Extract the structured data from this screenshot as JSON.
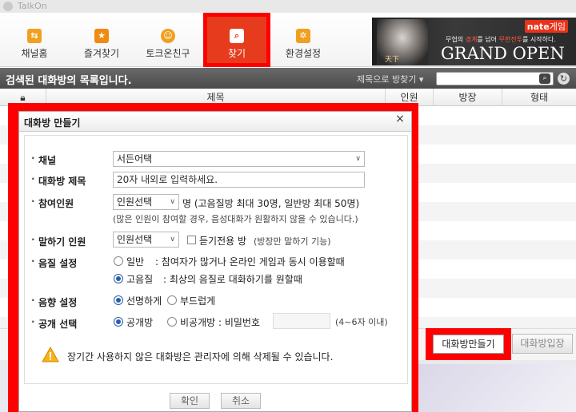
{
  "window": {
    "title": "TalkOn"
  },
  "toolbar": {
    "items": [
      {
        "label": "채널홈",
        "icon": "channel-home-icon",
        "color": "#f0a020"
      },
      {
        "label": "즐겨찾기",
        "icon": "star-icon",
        "color": "#f08a10"
      },
      {
        "label": "토크온친구",
        "icon": "friend-icon",
        "color": "#f0a020"
      },
      {
        "label": "찾기",
        "icon": "search-icon",
        "color": "#e63b1c",
        "active": true
      },
      {
        "label": "환경설정",
        "icon": "gear-icon",
        "color": "#f0a020"
      }
    ]
  },
  "banner": {
    "brand": "nate",
    "brand_suffix": "게임",
    "copy_pre": "무협의 ",
    "copy_em1": "경계",
    "copy_mid": "를 넘어 ",
    "copy_em2": "무한전투",
    "copy_post": "를 시작하다.",
    "headline": "GRAND OPEN",
    "logo": "天下"
  },
  "search": {
    "title": "검색된 대화방의 목록입니다.",
    "mode": "제목으로 방찾기 ▾",
    "query": ""
  },
  "table": {
    "columns": [
      "제목",
      "인원",
      "방장",
      "형태"
    ]
  },
  "buttons": {
    "create_room": "대화방만들기",
    "enter_room": "대화방입장"
  },
  "dialog": {
    "title": "대화방 만들기",
    "close": "×",
    "channel": {
      "label": "채널",
      "value": "서든어택"
    },
    "room_title": {
      "label": "대화방 제목",
      "placeholder": "20자 내외로 입력하세요."
    },
    "members": {
      "label": "참여인원",
      "value": "인원선택",
      "suffix": "명 (고음질방 최대 30명, 일반방 최대 50명)",
      "note": "(많은 인원이 참여할 경우, 음성대화가 원활하지 않을 수 있습니다.)"
    },
    "speakers": {
      "label": "말하기 인원",
      "value": "인원선택",
      "checkbox_label": "듣기전용 방",
      "checkbox_note": "(방장만 말하기 기능)"
    },
    "quality": {
      "label": "음질 설정",
      "options": [
        {
          "name": "일반",
          "desc": ": 참여자가 많거나 온라인 게임과 동시 이용할때",
          "selected": false
        },
        {
          "name": "고음질",
          "desc": ": 최상의 음질로 대화하기를 원할때",
          "selected": true
        }
      ]
    },
    "sound": {
      "label": "음향 설정",
      "options": [
        {
          "name": "선명하게",
          "selected": true
        },
        {
          "name": "부드럽게",
          "selected": false
        }
      ]
    },
    "visibility": {
      "label": "공개 선택",
      "public": "공개방",
      "private": "비공개방 : 비밀번호",
      "pw_hint": "(4~6자 이내)"
    },
    "warning": "장기간 사용하지 않은 대화방은 관리자에 의해 삭제될 수 있습니다.",
    "ok": "확인",
    "cancel": "취소"
  }
}
